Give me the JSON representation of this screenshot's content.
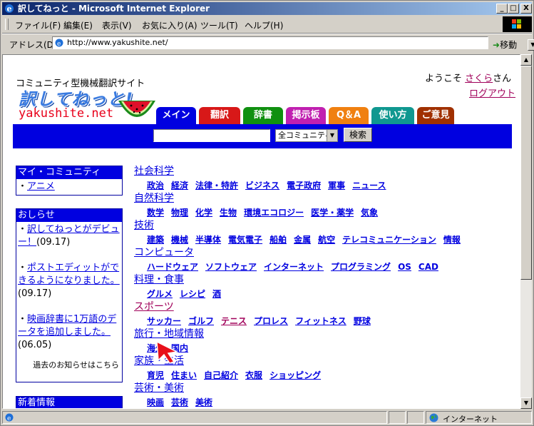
{
  "window": {
    "title": "訳してねっと - Microsoft Internet Explorer",
    "controls": {
      "minimize": "_",
      "maximize": "□",
      "close": "X"
    }
  },
  "menubar": [
    "ファイル(F)",
    "編集(E)",
    "表示(V)",
    "お気に入り(A)",
    "ツール(T)",
    "ヘルプ(H)"
  ],
  "address": {
    "label": "アドレス(D)",
    "url": "http://www.yakushite.net/",
    "go_label": "移動"
  },
  "status": {
    "zone": "インターネット"
  },
  "header": {
    "tagline": "コミュニティ型機械翻訳サイト",
    "logo_main": "訳してねっと!",
    "logo_sub": "yakushite.net",
    "welcome_prefix": "ようこそ",
    "username": "さくら",
    "welcome_suffix": "さん",
    "logout": "ログアウト"
  },
  "tabs": [
    {
      "label": "メイン",
      "color": "#0000e0"
    },
    {
      "label": "翻訳",
      "color": "#d81818"
    },
    {
      "label": "辞書",
      "color": "#109010"
    },
    {
      "label": "掲示板",
      "color": "#c020b0"
    },
    {
      "label": "Q＆A",
      "color": "#f08010"
    },
    {
      "label": "使い方",
      "color": "#109890"
    },
    {
      "label": "ご意見",
      "color": "#a03000"
    }
  ],
  "search": {
    "input_value": "",
    "select_value": "全コミュニティ",
    "button": "検索"
  },
  "sidebar": {
    "my_community": {
      "title": "マイ・コミュニティ",
      "items": [
        "アニメ"
      ]
    },
    "news": {
      "title": "おしらせ",
      "items": [
        {
          "text": "訳してねっとがデビュー！",
          "date": "(09.17)"
        },
        {
          "text": "ポストエディットができるようになりました。",
          "date": "(09.17)"
        },
        {
          "text": "映画辞書に1万語のデータを追加しました。",
          "date": "(06.05)"
        }
      ],
      "more": "過去のお知らせはこちら"
    },
    "new_info": {
      "title": "新着情報"
    }
  },
  "categories": [
    {
      "name": "社会科学",
      "subs": [
        "政治",
        "経済",
        "法律・特許",
        "ビジネス",
        "電子政府",
        "軍事",
        "ニュース"
      ]
    },
    {
      "name": "自然科学",
      "subs": [
        "数学",
        "物理",
        "化学",
        "生物",
        "環境エコロジー",
        "医学・薬学",
        "気象"
      ]
    },
    {
      "name": "技術",
      "subs": [
        "建築",
        "機械",
        "半導体",
        "電気電子",
        "船舶",
        "金属",
        "航空",
        "テレコミュニケーション",
        "情報"
      ]
    },
    {
      "name": "コンピュータ",
      "subs": [
        "ハードウェア",
        "ソフトウェア",
        "インターネット",
        "プログラミング",
        "OS",
        "CAD"
      ]
    },
    {
      "name": "料理・食事",
      "subs": [
        "グルメ",
        "レシピ",
        "酒"
      ]
    },
    {
      "name": "スポーツ",
      "subs": [
        "サッカー",
        "ゴルフ",
        "テニス",
        "プロレス",
        "フィットネス",
        "野球"
      ]
    },
    {
      "name": "旅行・地域情報",
      "subs": [
        "海外",
        "国内"
      ]
    },
    {
      "name": "家族・生活",
      "subs": [
        "育児",
        "住まい",
        "自己紹介",
        "衣服",
        "ショッピング"
      ]
    },
    {
      "name": "芸術・美術",
      "subs": [
        "映画",
        "芸術",
        "美術"
      ]
    }
  ]
}
